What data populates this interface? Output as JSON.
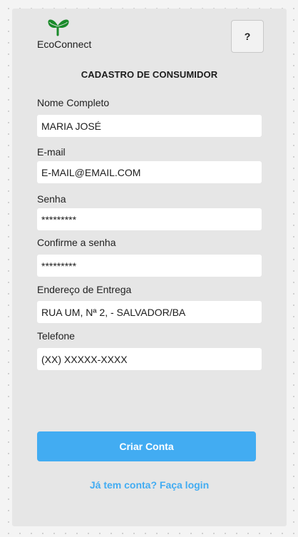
{
  "brand": {
    "name": "EcoConnect",
    "logo_icon": "sprout-icon",
    "logo_color": "#1a8a2a"
  },
  "header": {
    "help_label": "?"
  },
  "form": {
    "title": "CADASTRO DE CONSUMIDOR",
    "fields": [
      {
        "label": "Nome Completo",
        "value": "MARIA JOSÉ"
      },
      {
        "label": "E-mail",
        "value": "E-MAIL@EMAIL.COM"
      },
      {
        "label": "Senha",
        "value": "*********"
      },
      {
        "label": "Confirme a senha",
        "value": "*********"
      },
      {
        "label": "Endereço de Entrega",
        "value": "RUA UM, Nª 2, - SALVADOR/BA"
      },
      {
        "label": "Telefone",
        "value": "(XX) XXXXX-XXXX"
      }
    ],
    "submit_label": "Criar Conta",
    "login_link": "Já tem conta? Faça login"
  },
  "colors": {
    "accent": "#42acf2",
    "card_bg": "#e6e6e6",
    "input_bg": "#ffffff"
  }
}
